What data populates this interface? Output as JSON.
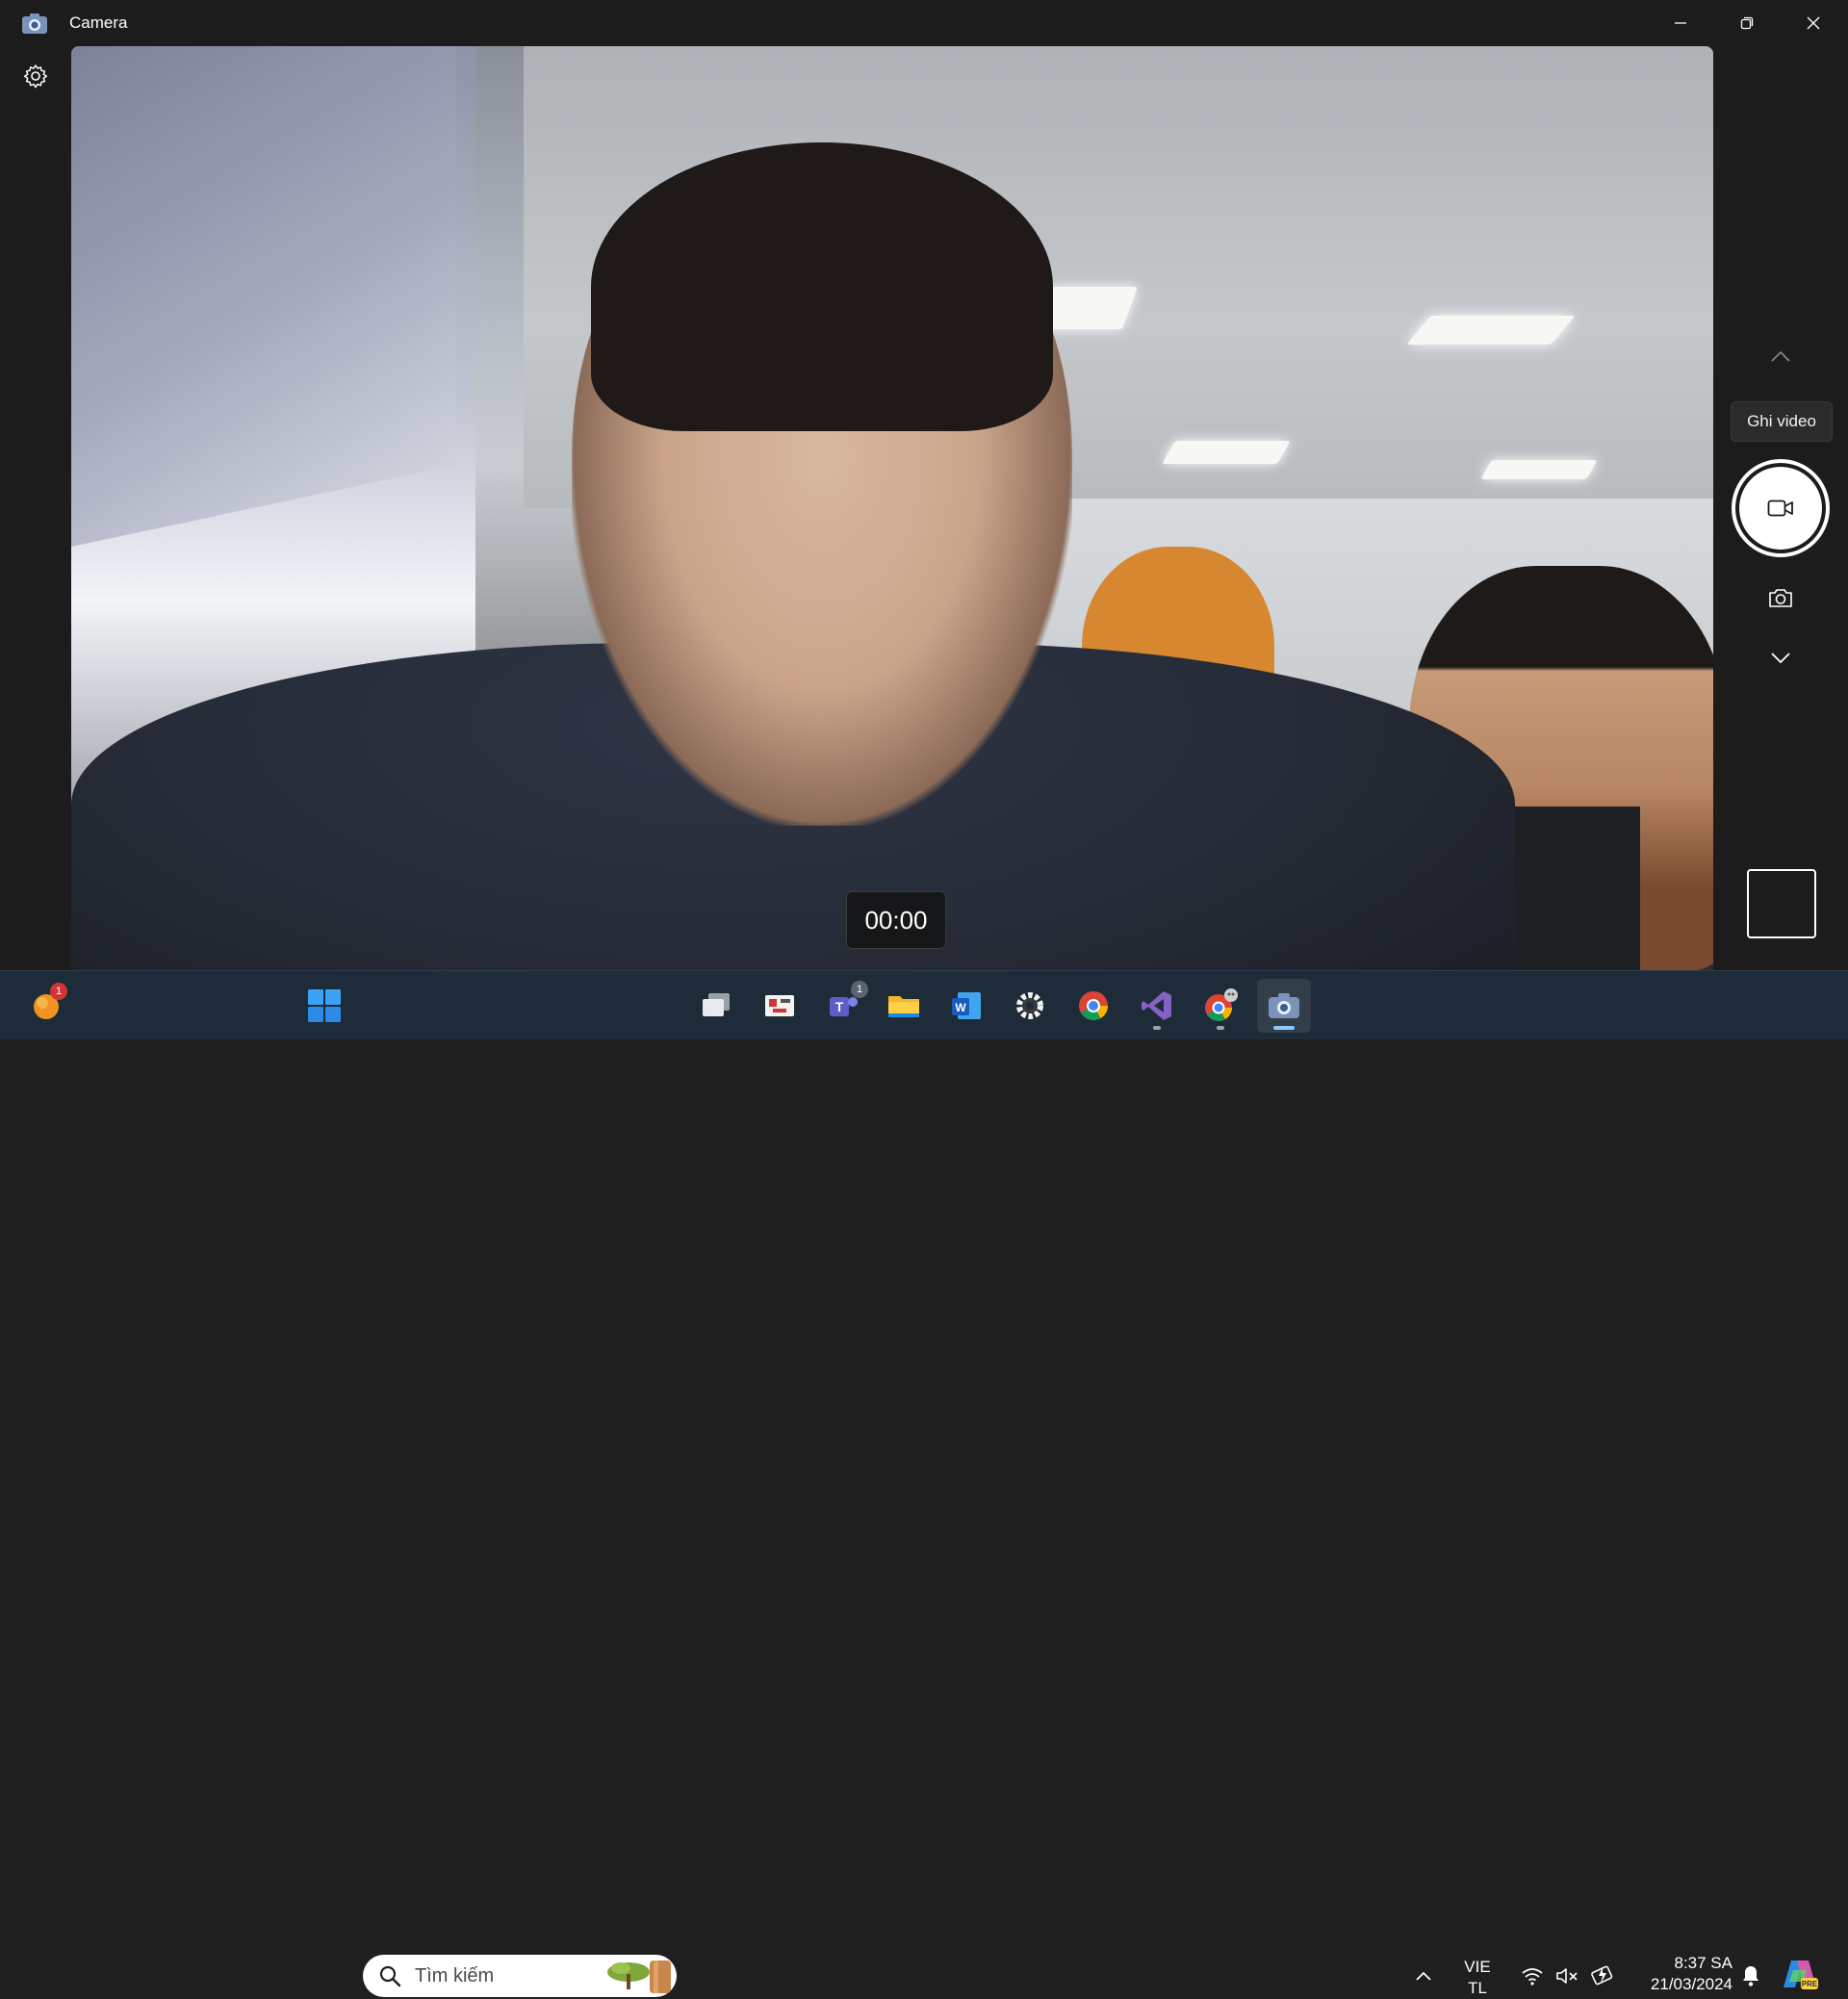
{
  "window": {
    "title": "Camera"
  },
  "viewfinder": {
    "timer": "00:00"
  },
  "side_rail": {
    "tooltip": "Ghi video"
  },
  "taskbar": {
    "widgets_badge": "1",
    "search_placeholder": "Tìm kiếm",
    "teams_badge": "1",
    "language": {
      "line1": "VIE",
      "line2": "TL"
    },
    "clock": {
      "time": "8:37 SA",
      "date": "21/03/2024"
    },
    "apps": [
      "start-icon",
      "task-view-icon",
      "snipping-tool-icon",
      "teams-icon",
      "file-explorer-icon",
      "word-icon",
      "settings-icon",
      "chrome-icon",
      "visual-studio-icon",
      "chrome-profile-icon",
      "camera-app-icon"
    ],
    "colors": {
      "background": "#1e2b38",
      "accent": "#8fc7ff"
    }
  }
}
